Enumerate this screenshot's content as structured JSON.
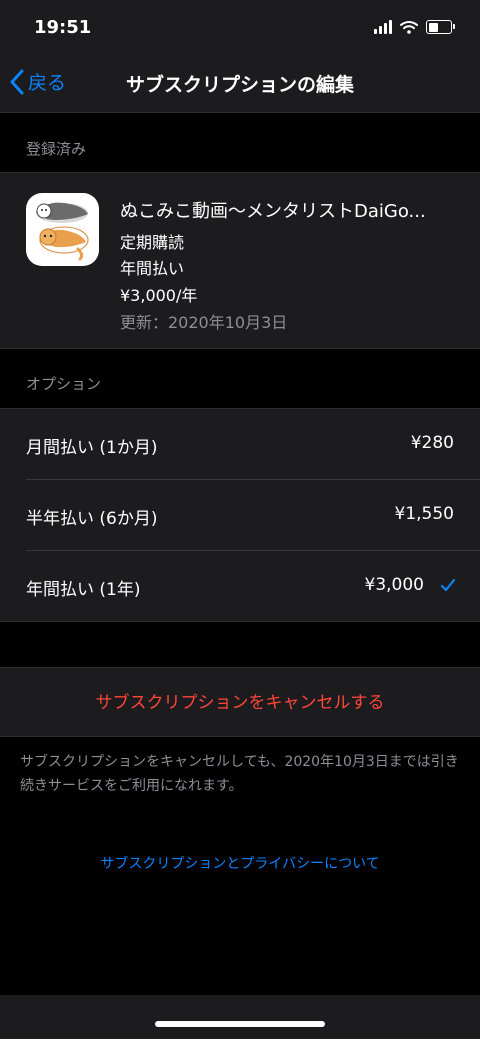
{
  "status": {
    "time": "19:51"
  },
  "nav": {
    "back_label": "戻る",
    "title": "サブスクリプションの編集"
  },
  "registered": {
    "header": "登録済み",
    "subscription": {
      "name": "ぬこみこ動画〜メンタリストDaiGo...",
      "type": "定期購読",
      "plan": "年間払い",
      "price": "¥3,000/年",
      "renewal": "更新：2020年10月3日"
    }
  },
  "options": {
    "header": "オプション",
    "items": [
      {
        "label": "月間払い (1か月)",
        "price": "¥280",
        "selected": false
      },
      {
        "label": "半年払い (6か月)",
        "price": "¥1,550",
        "selected": false
      },
      {
        "label": "年間払い (1年)",
        "price": "¥3,000",
        "selected": true
      }
    ]
  },
  "cancel": {
    "button_label": "サブスクリプションをキャンセルする",
    "notice": "サブスクリプションをキャンセルしても、2020年10月3日までは引き続きサービスをご利用になれます。"
  },
  "privacy_link": "サブスクリプションとプライバシーについて",
  "colors": {
    "accent": "#0a84ff",
    "destructive": "#ff453a",
    "background": "#000000",
    "panel": "#1c1c1e"
  }
}
